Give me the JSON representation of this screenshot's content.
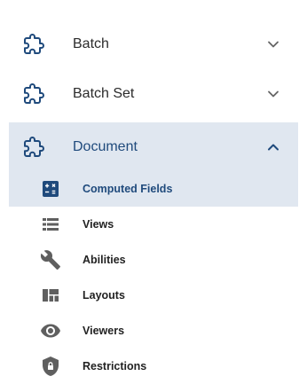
{
  "colors": {
    "accent": "#1f4a7c",
    "selected_bg": "#e0e7f0",
    "icon_grey": "#5f5f5f",
    "text": "#2b2b2b"
  },
  "groups": [
    {
      "label": "Batch",
      "icon": "puzzle-icon",
      "expanded": false
    },
    {
      "label": "Batch Set",
      "icon": "puzzle-icon",
      "expanded": false
    },
    {
      "label": "Document",
      "icon": "puzzle-icon",
      "expanded": true,
      "selected": true
    }
  ],
  "document_items": [
    {
      "label": "Computed Fields",
      "icon": "calculator-icon",
      "selected": true
    },
    {
      "label": "Views",
      "icon": "list-icon"
    },
    {
      "label": "Abilities",
      "icon": "wrench-icon"
    },
    {
      "label": "Layouts",
      "icon": "layout-icon"
    },
    {
      "label": "Viewers",
      "icon": "eye-icon"
    },
    {
      "label": "Restrictions",
      "icon": "shield-lock-icon"
    }
  ]
}
